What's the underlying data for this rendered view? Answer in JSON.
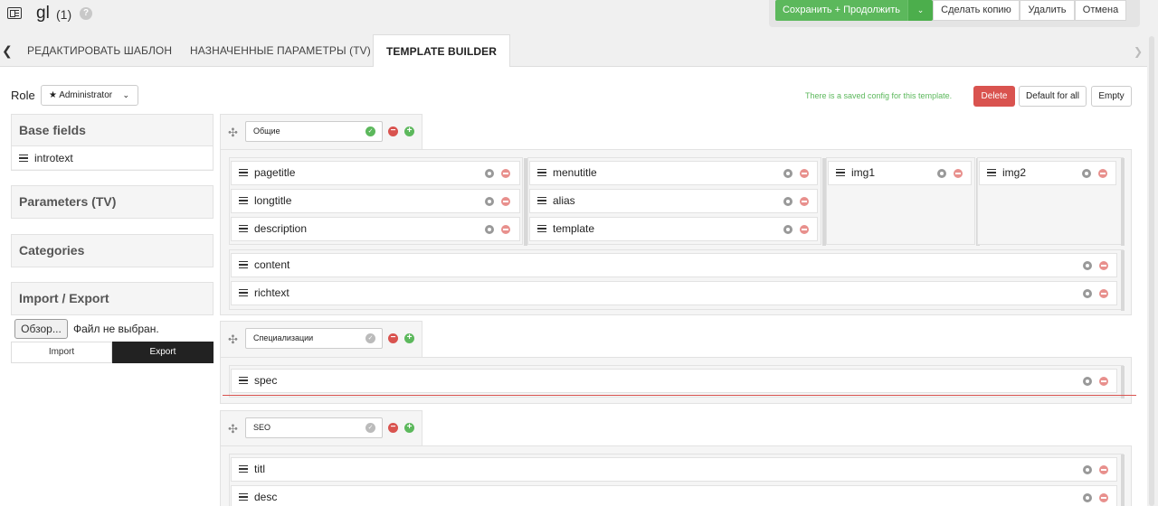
{
  "header": {
    "title": "gl",
    "count": "(1)",
    "help": "?",
    "save_label": "Сохранить + Продолжить",
    "save_caret": "⌄",
    "copy_label": "Сделать копию",
    "delete_label": "Удалить",
    "cancel_label": "Отмена"
  },
  "tabs": [
    {
      "label": "РЕДАКТИРОВАТЬ ШАБЛОН"
    },
    {
      "label": "НАЗНАЧЕННЫЕ ПАРАМЕТРЫ (TV)"
    },
    {
      "label": "TEMPLATE BUILDER"
    }
  ],
  "toolbar": {
    "role_label": "Role",
    "role_value": "★ Administrator",
    "saved_msg": "There is a saved config for this template.",
    "delete_label": "Delete",
    "default_label": "Default for all",
    "empty_label": "Empty"
  },
  "sidebar": {
    "base_fields": "Base fields",
    "base_items": [
      {
        "label": "introtext"
      }
    ],
    "parameters": "Parameters (TV)",
    "categories": "Categories",
    "import_export": "Import / Export",
    "browse_label": "Обзор...",
    "file_status": "Файл не выбран.",
    "import_label": "Import",
    "export_label": "Export"
  },
  "groups": [
    {
      "name": "Общие",
      "fields": [
        "pagetitle",
        "longtitle",
        "description",
        "menutitle",
        "alias",
        "template",
        "img1",
        "img2",
        "content",
        "richtext"
      ]
    },
    {
      "name": "Специализации",
      "fields": [
        "spec"
      ]
    },
    {
      "name": "SEO",
      "fields": [
        "titl",
        "desc"
      ]
    }
  ],
  "colors": {
    "accent_green": "#5cb85c",
    "danger_red": "#d9534f"
  }
}
